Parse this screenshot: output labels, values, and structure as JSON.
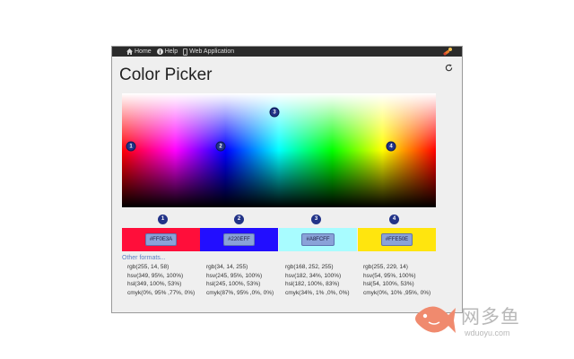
{
  "nav": {
    "home_label": "Home",
    "help_label": "Help",
    "webapp_label": "Web Application"
  },
  "page": {
    "title": "Color Picker"
  },
  "markers": [
    {
      "label": "1"
    },
    {
      "label": "2"
    },
    {
      "label": "3"
    },
    {
      "label": "4"
    }
  ],
  "swatches": [
    {
      "number": "1",
      "hex": "#FF0E3A",
      "color": "#ff0e3a",
      "rgb": "rgb(255, 14, 58)",
      "hsv": "hsv(349, 95%, 100%)",
      "hsl": "hsl(349, 100%, 53%)",
      "cmyk": "cmyk(0%, 95% ,77%, 0%)"
    },
    {
      "number": "2",
      "hex": "#220EFF",
      "color": "#220eff",
      "rgb": "rgb(34, 14, 255)",
      "hsv": "hsv(245, 95%, 100%)",
      "hsl": "hsl(245, 100%, 53%)",
      "cmyk": "cmyk(87%, 95% ,0%, 0%)"
    },
    {
      "number": "3",
      "hex": "#A8FCFF",
      "color": "#a8fcff",
      "rgb": "rgb(168, 252, 255)",
      "hsv": "hsv(182, 34%, 100%)",
      "hsl": "hsl(182, 100%, 83%)",
      "cmyk": "cmyk(34%, 1% ,0%, 0%)"
    },
    {
      "number": "4",
      "hex": "#FFE50E",
      "color": "#ffe50e",
      "rgb": "rgb(255, 229, 14)",
      "hsv": "hsv(54, 95%, 100%)",
      "hsl": "hsl(54, 100%, 53%)",
      "cmyk": "cmyk(0%, 10% ,95%, 0%)"
    }
  ],
  "other_formats_label": "Other formats...",
  "watermark": {
    "name": "网多鱼",
    "url": "wduoyu.com",
    "color": "#f08a6e"
  }
}
